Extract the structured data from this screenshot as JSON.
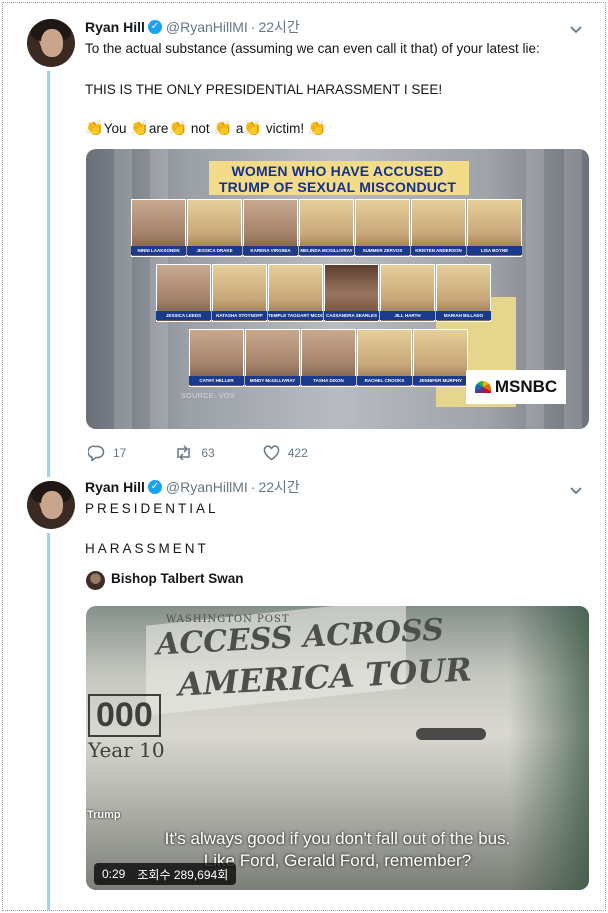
{
  "tweet1": {
    "name": "Ryan Hill",
    "handle": "@RyanHillMI",
    "time": "22시간",
    "line1": "To the actual substance (assuming we can even call it that) of your latest lie:",
    "line2": "THIS IS THE ONLY PRESIDENTIAL HARASSMENT I SEE!",
    "clap_words": [
      "You",
      "are",
      "not",
      "a",
      "victim!"
    ],
    "image": {
      "headline_1": "WOMEN WHO HAVE ACCUSED",
      "headline_2": "TRUMP OF SEXUAL MISCONDUCT",
      "row1": [
        "NINNI LAAKSONEN",
        "JESSICA DRAKE",
        "KARENA VIRGINIA",
        "MELINDA MCGILLIVRAY",
        "SUMMER ZERVOS",
        "KRISTEN ANDERSON",
        "LISA BOYNE"
      ],
      "row2": [
        "JESSICA LEEDS",
        "NATASHA STOYNOFF",
        "TEMPLE TAGGART MCDOWELL",
        "CASSANDRA SEARLES",
        "JILL HARTH",
        "MARIAH BILLADO"
      ],
      "row3": [
        "CATHY HELLER",
        "MINDY McGILLIVRAY",
        "TASHA DIXON",
        "RACHEL CROOKS",
        "JENNIFER MURPHY"
      ],
      "source": "SOURCE: VOX",
      "network": "MSNBC"
    },
    "replies": "17",
    "retweets": "63",
    "likes": "422"
  },
  "tweet2": {
    "name": "Ryan Hill",
    "handle": "@RyanHillMI",
    "time": "22시간",
    "line1": "PRESIDENTIAL",
    "line2": "HARASSMENT",
    "quoted_name": "Bishop Talbert Swan",
    "video": {
      "sign_small": "WASHINGTON POST",
      "sign_1": "ACCESS ACROSS",
      "sign_2": "AMERICA TOUR",
      "number": "000",
      "year": "Year 10",
      "speaker": "Trump",
      "subtitle_1": "It's always good if you don't fall out of the bus.",
      "subtitle_2": "Like Ford, Gerald Ford, remember?",
      "duration": "0:29",
      "views": "조회수 289,694회"
    }
  },
  "colors": {
    "accent": "#1da1f2",
    "thread": "#9cd2f2",
    "muted": "#657786"
  }
}
